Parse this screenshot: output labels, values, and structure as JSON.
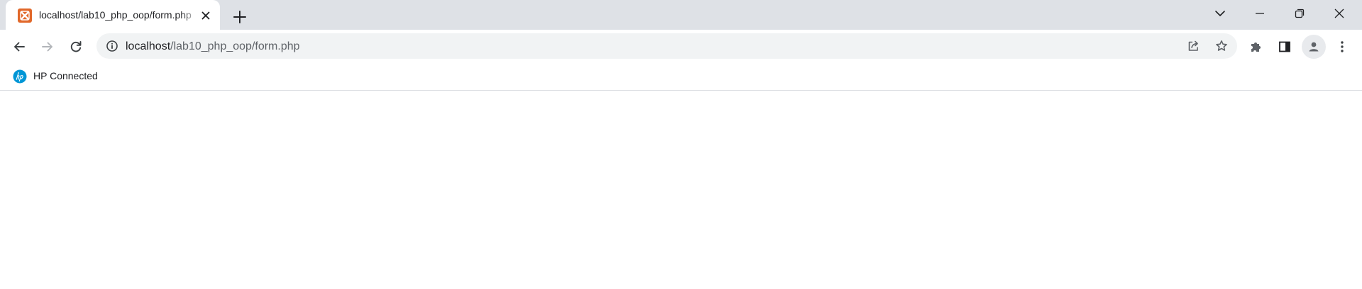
{
  "tab": {
    "title": "localhost/lab10_php_oop/form.php",
    "favicon": "xampp-icon",
    "close_icon": "close-icon"
  },
  "new_tab": {
    "icon": "plus-icon"
  },
  "window_controls": {
    "tab_search": "chevron-down-icon",
    "minimize": "minimize-icon",
    "restore": "restore-icon",
    "close": "close-icon"
  },
  "toolbar": {
    "back": "arrow-left-icon",
    "forward": "arrow-right-icon",
    "reload": "reload-icon",
    "extensions": "puzzle-icon",
    "side_panel": "side-panel-icon",
    "profile": "avatar-icon",
    "menu": "kebab-menu-icon"
  },
  "omnibox": {
    "host": "localhost",
    "path": "/lab10_php_oop/form.php",
    "site_info_icon": "info-icon",
    "share_icon": "share-icon",
    "bookmark_icon": "star-icon"
  },
  "bookmarks": [
    {
      "label": "HP Connected",
      "icon": "hp-logo-icon"
    }
  ],
  "colors": {
    "tabstrip_bg": "#dee1e6",
    "omnibox_bg": "#f1f3f4",
    "icon_gray": "#5f6368",
    "favicon_orange": "#e1682a",
    "hp_blue": "#0096d6"
  }
}
